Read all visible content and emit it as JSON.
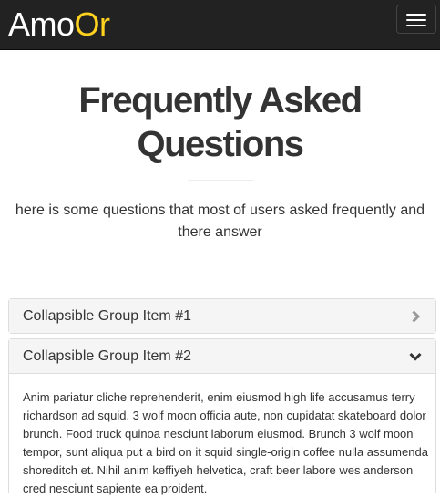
{
  "navbar": {
    "brand_part1": "Amo",
    "brand_part2": "Or",
    "brand_color_primary": "#ffffff",
    "brand_color_accent": "#ffd21f",
    "toggle_icon": "hamburger-menu-icon"
  },
  "faq": {
    "title": "Frequently Asked Questions",
    "subtitle": "here is some questions that most of users asked frequently and there answer"
  },
  "accordion": {
    "items": [
      {
        "title": "Collapsible Group Item #1",
        "state": "collapsed",
        "icon": "chevron-right-icon"
      },
      {
        "title": "Collapsible Group Item #2",
        "state": "expanded",
        "icon": "chevron-down-icon",
        "body": "Anim pariatur cliche reprehenderit, enim eiusmod high life accusamus terry richardson ad squid. 3 wolf moon officia aute, non cupidatat skateboard dolor brunch. Food truck quinoa nesciunt laborum eiusmod. Brunch 3 wolf moon tempor, sunt aliqua put a bird on it squid single-origin coffee nulla assumenda shoreditch et. Nihil anim keffiyeh helvetica, craft beer labore wes anderson cred nesciunt sapiente ea proident."
      }
    ]
  }
}
